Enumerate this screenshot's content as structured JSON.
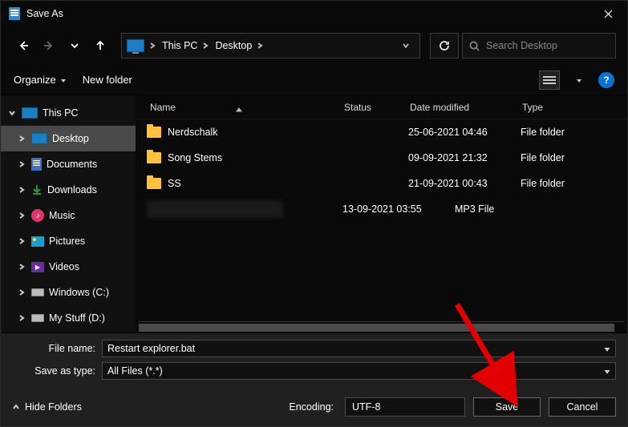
{
  "title": "Save As",
  "nav": {
    "crumb_root": "This PC",
    "crumb_current": "Desktop",
    "search_placeholder": "Search Desktop"
  },
  "toolbar": {
    "organize": "Organize",
    "new_folder": "New folder",
    "help": "?"
  },
  "sidebar": {
    "items": [
      {
        "label": "This PC",
        "icon": "monitor",
        "exp": "down",
        "sel": false
      },
      {
        "label": "Desktop",
        "icon": "monitor",
        "exp": "right",
        "sel": true
      },
      {
        "label": "Documents",
        "icon": "doc",
        "exp": "right",
        "sel": false
      },
      {
        "label": "Downloads",
        "icon": "dl",
        "exp": "right",
        "sel": false
      },
      {
        "label": "Music",
        "icon": "music",
        "exp": "right",
        "sel": false
      },
      {
        "label": "Pictures",
        "icon": "pic",
        "exp": "right",
        "sel": false
      },
      {
        "label": "Videos",
        "icon": "vid",
        "exp": "right",
        "sel": false
      },
      {
        "label": "Windows (C:)",
        "icon": "disk",
        "exp": "right",
        "sel": false
      },
      {
        "label": "My Stuff (D:)",
        "icon": "disk",
        "exp": "right",
        "sel": false
      }
    ]
  },
  "columns": {
    "name": "Name",
    "status": "Status",
    "date": "Date modified",
    "type": "Type"
  },
  "files": [
    {
      "name": "Nerdschalk",
      "date": "25-06-2021 04:46",
      "type": "File folder",
      "icon": "folder"
    },
    {
      "name": "Song Stems",
      "date": "09-09-2021 21:32",
      "type": "File folder",
      "icon": "folder"
    },
    {
      "name": "SS",
      "date": "21-09-2021 00:43",
      "type": "File folder",
      "icon": "folder"
    },
    {
      "name": "",
      "date": "13-09-2021 03:55",
      "type": "MP3 File",
      "icon": "redact"
    }
  ],
  "form": {
    "filename_label": "File name:",
    "filename_value": "Restart explorer.bat",
    "type_label": "Save as type:",
    "type_value": "All Files  (*.*)",
    "encoding_label": "Encoding:",
    "encoding_value": "UTF-8",
    "hide_folders": "Hide Folders",
    "save": "Save",
    "cancel": "Cancel"
  }
}
